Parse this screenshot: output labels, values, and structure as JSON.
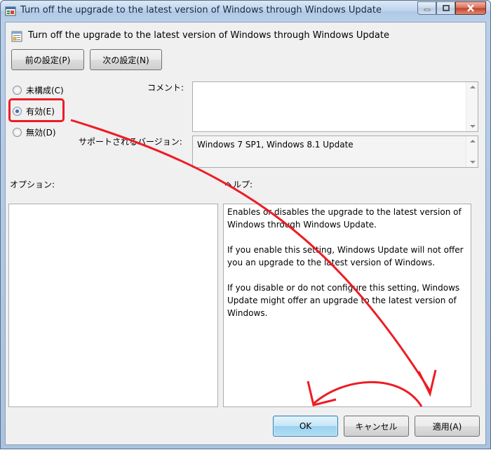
{
  "window": {
    "title": "Turn off the upgrade to the latest version of Windows through Windows Update",
    "controls": {
      "minimize": "minimize",
      "maximize": "maximize",
      "close": "close"
    }
  },
  "header": {
    "policy_title": "Turn off the upgrade to the latest version of Windows through Windows Update",
    "prev_button": "前の設定(P)",
    "next_button": "次の設定(N)"
  },
  "state": {
    "options": [
      {
        "label": "未構成(C)",
        "selected": false
      },
      {
        "label": "有効(E)",
        "selected": true
      },
      {
        "label": "無効(D)",
        "selected": false
      }
    ]
  },
  "comment": {
    "label": "コメント:",
    "value": ""
  },
  "supported": {
    "label": "サポートされるバージョン:",
    "value": "Windows 7 SP1, Windows 8.1 Update"
  },
  "options_panel": {
    "label": "オプション:"
  },
  "help_panel": {
    "label": "ヘルプ:",
    "paragraphs": [
      "Enables or disables the upgrade to the latest version of Windows through Windows Update.",
      "If you enable this setting, Windows Update will not offer you an upgrade to the latest version of Windows.",
      "If you disable or do not configure this setting, Windows Update might offer an upgrade to the latest version of Windows."
    ]
  },
  "footer": {
    "ok": "OK",
    "cancel": "キャンセル",
    "apply": "適用(A)"
  },
  "annotation": {
    "color": "#ee1c25"
  }
}
